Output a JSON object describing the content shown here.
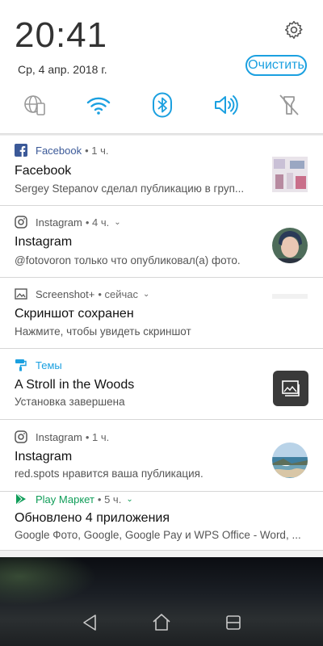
{
  "header": {
    "time": "20:41",
    "date": "Ср, 4 апр. 2018 г.",
    "clear_label": "Очистить"
  },
  "quick_settings": [
    "globe-phone-icon",
    "wifi-icon",
    "bluetooth-icon",
    "volume-icon",
    "flashlight-off-icon"
  ],
  "accent_color": "#1ba0e0",
  "notifications": [
    {
      "app": "Facebook",
      "time": "• 1 ч.",
      "title": "Facebook",
      "text": "Sergey Stepanov сделал публикацию в груп..."
    },
    {
      "app": "Instagram",
      "time": "• 4 ч.",
      "title": "Instagram",
      "text": "@fotovoron только что опубликовал(а) фото."
    },
    {
      "app": "Screenshot+",
      "time": "• сейчас",
      "title": "Скриншот сохранен",
      "text": "Нажмите, чтобы увидеть скриншот"
    },
    {
      "app": "Темы",
      "time": "",
      "title": "A Stroll in the Woods",
      "text": "Установка завершена"
    },
    {
      "app": "Instagram",
      "time": "• 1 ч.",
      "title": "Instagram",
      "text": "red.spots нравится ваша публикация."
    },
    {
      "app": "Play Маркет",
      "time": "• 5 ч.",
      "title": "Обновлено 4 приложения",
      "text": "Google Фото, Google, Google Pay и WPS Office - Word, ..."
    }
  ],
  "nav": [
    "back-icon",
    "home-icon",
    "recents-icon"
  ]
}
